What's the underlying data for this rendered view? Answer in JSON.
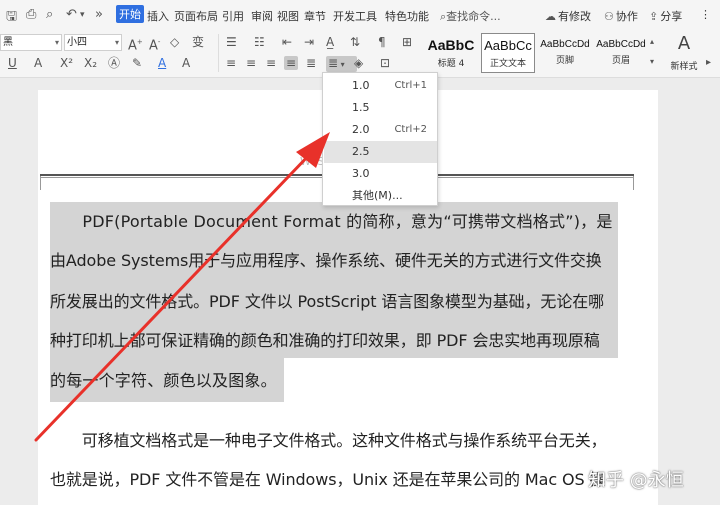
{
  "menubar": {
    "tabs": [
      "开始",
      "插入",
      "页面布局",
      "引用",
      "审阅",
      "视图",
      "章节",
      "开发工具",
      "特色功能"
    ],
    "active_tab": "开始",
    "search": "查找命令...",
    "right_buttons": [
      "有修改",
      "协作",
      "分享"
    ]
  },
  "ribbon": {
    "font_name": "黑",
    "font_size": "小四",
    "styles": [
      {
        "sample": "AaBbC",
        "name": "标题 4"
      },
      {
        "sample": "AaBbCc",
        "name": "正文文本"
      },
      {
        "sample": "AaBbCcDd",
        "name": "页脚"
      },
      {
        "sample": "AaBbCcDd",
        "name": "页眉"
      }
    ],
    "new_style_label": "新样式"
  },
  "line_spacing_menu": {
    "items": [
      {
        "label": "1.0",
        "shortcut": "Ctrl+1"
      },
      {
        "label": "1.5",
        "shortcut": ""
      },
      {
        "label": "2.0",
        "shortcut": "Ctrl+2"
      },
      {
        "label": "2.5",
        "shortcut": ""
      },
      {
        "label": "3.0",
        "shortcut": ""
      },
      {
        "label": "其他(M)...",
        "shortcut": ""
      }
    ],
    "hovered": "2.5"
  },
  "document": {
    "header_mark": "WPS",
    "paragraph1_lines": [
      "　　PDF(Portable Document Format 的简称，意为“可携带文档格式”)，是",
      "由Adobe Systems用于与应用程序、操作系统、硬件无关的方式进行文件交换",
      "所发展出的文件格式。PDF 文件以 PostScript 语言图象模型为基础，无论在哪",
      "种打印机上都可保证精确的颜色和准确的打印效果，即 PDF 会忠实地再现原稿",
      "的每一个字符、颜色以及图象。"
    ],
    "paragraph2_lines": [
      "　　可移植文档格式是一种电子文件格式。这种文件格式与操作系统平台无关，",
      "也就是说，PDF 文件不管是在 Windows，Unix 还是在苹果公司的 Mac OS 操"
    ]
  },
  "watermark": "知乎 @永恒",
  "colors": {
    "accent": "#2f6fe0",
    "selection": "#d4d4d4",
    "annotation_arrow": "#e8312a"
  }
}
